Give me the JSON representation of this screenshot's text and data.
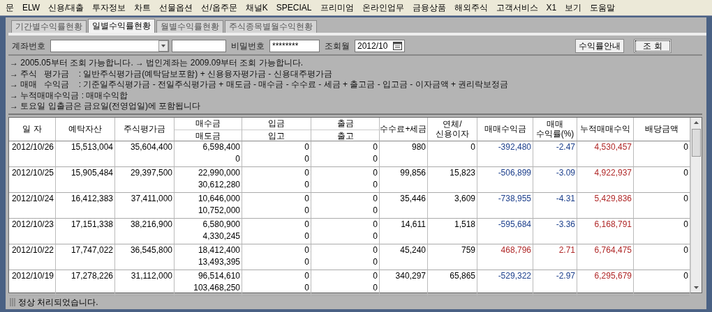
{
  "menu": [
    "문",
    "ELW",
    "신용/대출",
    "투자정보",
    "차트",
    "선물옵션",
    "선/옵주문",
    "채널K",
    "SPECIAL",
    "프리미엄",
    "온라인업무",
    "금융상품",
    "해외주식",
    "고객서비스",
    "X1",
    "보기",
    "도움말"
  ],
  "tabs": [
    {
      "label": "기간별수익률현황",
      "selected": false
    },
    {
      "label": "일별수익률현황",
      "selected": true
    },
    {
      "label": "월별수익률현황",
      "selected": false
    },
    {
      "label": "주식종목별월수익현황",
      "selected": false
    }
  ],
  "form": {
    "account_label": "계좌번호",
    "password_label": "비밀번호",
    "password": "********",
    "month_label": "조회월",
    "month": "2012/10",
    "buttons": [
      "수익률안내",
      "조 회"
    ]
  },
  "notes": [
    "→ 2005.05부터 조회 가능합니다. → 법인계좌는 2009.09부터 조회 가능합니다.",
    "→ 주식   평가금    : 일반주식평가금(예탁담보포함) + 신용융자평가금 - 신용대주평가금",
    "→ 매매   수익금    : 기준일주식평가금 - 전일주식평가금 + 매도금 - 매수금 - 수수료 - 세금 + 출고금 - 입고금 - 이자금액 + 권리락보정금",
    "→ 누적매매수익금 : 매매수익합",
    "→ 토요일 입출금은 금요일(전영업일)에 포함됩니다"
  ],
  "table": {
    "columns": [
      {
        "label": "일 자"
      },
      {
        "label": "예탁자산"
      },
      {
        "label": "주식평가금"
      },
      {
        "label": "매수금",
        "sub": "매도금"
      },
      {
        "label": "입금",
        "sub": "입고"
      },
      {
        "label": "출금",
        "sub": "출고"
      },
      {
        "label": "수수료+세금"
      },
      {
        "label": "연체/",
        "sub": "신용이자",
        "kind": "stack"
      },
      {
        "label": "매매수익금"
      },
      {
        "label": "매매",
        "sub": "수익률(%)",
        "kind": "stack"
      },
      {
        "label": "누적매매수익"
      },
      {
        "label": "배당금액"
      }
    ],
    "rows": [
      {
        "date": "2012/10/26",
        "deposit": "15,513,004",
        "stock_value": "35,604,400",
        "buy": "6,598,400",
        "sell": "0",
        "cash_in": "0",
        "stock_in": "0",
        "cash_out": "0",
        "stock_out": "0",
        "fee_tax": "980",
        "interest": "0",
        "profit": "-392,480",
        "rate": "-2.47",
        "cumulative": "4,530,457",
        "dividend": "0",
        "color": "#1c3f8c"
      },
      {
        "date": "2012/10/25",
        "deposit": "15,905,484",
        "stock_value": "29,397,500",
        "buy": "22,990,000",
        "sell": "30,612,280",
        "cash_in": "0",
        "stock_in": "0",
        "cash_out": "0",
        "stock_out": "0",
        "fee_tax": "99,856",
        "interest": "15,823",
        "profit": "-506,899",
        "rate": "-3.09",
        "cumulative": "4,922,937",
        "dividend": "0",
        "color": "#1c3f8c"
      },
      {
        "date": "2012/10/24",
        "deposit": "16,412,383",
        "stock_value": "37,411,000",
        "buy": "10,646,000",
        "sell": "10,752,000",
        "cash_in": "0",
        "stock_in": "0",
        "cash_out": "0",
        "stock_out": "0",
        "fee_tax": "35,446",
        "interest": "3,609",
        "profit": "-738,955",
        "rate": "-4.31",
        "cumulative": "5,429,836",
        "dividend": "0",
        "color": "#1c3f8c"
      },
      {
        "date": "2012/10/23",
        "deposit": "17,151,338",
        "stock_value": "38,216,900",
        "buy": "6,580,900",
        "sell": "4,330,245",
        "cash_in": "0",
        "stock_in": "0",
        "cash_out": "0",
        "stock_out": "0",
        "fee_tax": "14,611",
        "interest": "1,518",
        "profit": "-595,684",
        "rate": "-3.36",
        "cumulative": "6,168,791",
        "dividend": "0",
        "color": "#1c3f8c"
      },
      {
        "date": "2012/10/22",
        "deposit": "17,747,022",
        "stock_value": "36,545,800",
        "buy": "18,412,400",
        "sell": "13,493,395",
        "cash_in": "0",
        "stock_in": "0",
        "cash_out": "0",
        "stock_out": "0",
        "fee_tax": "45,240",
        "interest": "759",
        "profit": "468,796",
        "rate": "2.71",
        "cumulative": "6,764,475",
        "dividend": "0",
        "color": "#b02828"
      },
      {
        "date": "2012/10/19",
        "deposit": "17,278,226",
        "stock_value": "31,112,000",
        "buy": "96,514,610",
        "sell": "103,468,250",
        "cash_in": "0",
        "stock_in": "0",
        "cash_out": "0",
        "stock_out": "0",
        "fee_tax": "340,297",
        "interest": "65,865",
        "profit": "-529,322",
        "rate": "-2.97",
        "cumulative": "6,295,679",
        "dividend": "0",
        "color": "#1c3f8c"
      }
    ]
  },
  "status_bar": "정상 처리되었습니다."
}
